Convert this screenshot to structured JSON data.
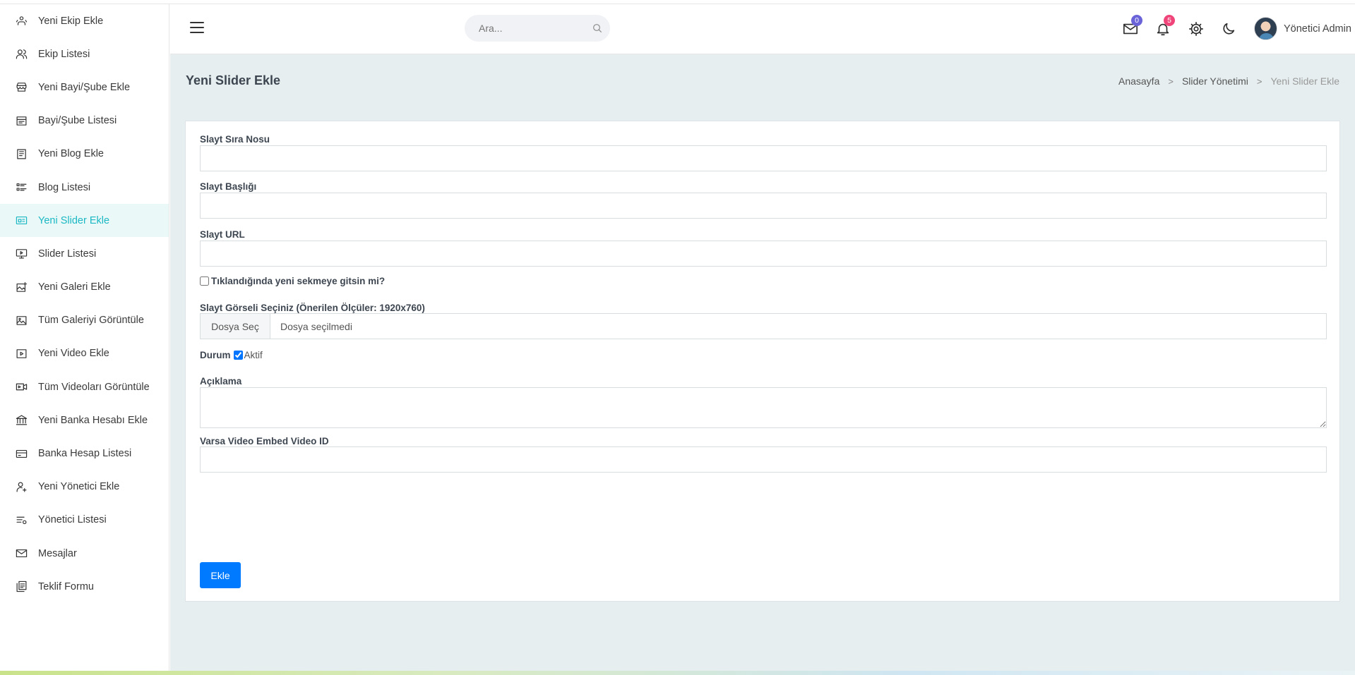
{
  "sidebar": {
    "items": [
      {
        "label": "Yeni Ekip Ekle",
        "icon": "users-add-icon"
      },
      {
        "label": "Ekip Listesi",
        "icon": "users-icon"
      },
      {
        "label": "Yeni Bayi/Şube Ekle",
        "icon": "store-icon"
      },
      {
        "label": "Bayi/Şube Listesi",
        "icon": "store-list-icon"
      },
      {
        "label": "Yeni Blog Ekle",
        "icon": "blog-icon"
      },
      {
        "label": "Blog Listesi",
        "icon": "list-icon"
      },
      {
        "label": "Yeni Slider Ekle",
        "icon": "slider-icon",
        "active": true
      },
      {
        "label": "Slider Listesi",
        "icon": "monitor-icon"
      },
      {
        "label": "Yeni Galeri Ekle",
        "icon": "gallery-add-icon"
      },
      {
        "label": "Tüm Galeriyi Görüntüle",
        "icon": "image-icon"
      },
      {
        "label": "Yeni Video Ekle",
        "icon": "video-icon"
      },
      {
        "label": "Tüm Videoları Görüntüle",
        "icon": "camera-icon"
      },
      {
        "label": "Yeni Banka Hesabı Ekle",
        "icon": "bank-icon"
      },
      {
        "label": "Banka Hesap Listesi",
        "icon": "card-icon"
      },
      {
        "label": "Yeni Yönetici Ekle",
        "icon": "user-add-icon"
      },
      {
        "label": "Yönetici Listesi",
        "icon": "user-list-icon"
      },
      {
        "label": "Mesajlar",
        "icon": "mail-icon"
      },
      {
        "label": "Teklif Formu",
        "icon": "form-icon"
      }
    ]
  },
  "topbar": {
    "search_placeholder": "Ara...",
    "mail_badge": "0",
    "notification_badge": "5",
    "username": "Yönetici Admin"
  },
  "page": {
    "title": "Yeni Slider Ekle",
    "breadcrumb": [
      "Anasayfa",
      "Slider Yönetimi",
      "Yeni Slider Ekle"
    ]
  },
  "form": {
    "order_label": "Slayt Sıra Nosu",
    "title_label": "Slayt Başlığı",
    "url_label": "Slayt URL",
    "new_tab_label": "Tıklandığında yeni sekmeye gitsin mi?",
    "new_tab_checked": false,
    "image_label": "Slayt Görseli Seçiniz (Önerilen Ölçüler: 1920x760)",
    "file_button": "Dosya Seç",
    "file_status": "Dosya seçilmedi",
    "status_label": "Durum",
    "status_option": "Aktif",
    "status_checked": true,
    "description_label": "Açıklama",
    "video_label": "Varsa Video Embed Video ID",
    "submit_label": "Ekle"
  },
  "colors": {
    "accent": "#1bb8c4",
    "primary_button": "#007bff",
    "main_bg": "#e6eef0"
  }
}
